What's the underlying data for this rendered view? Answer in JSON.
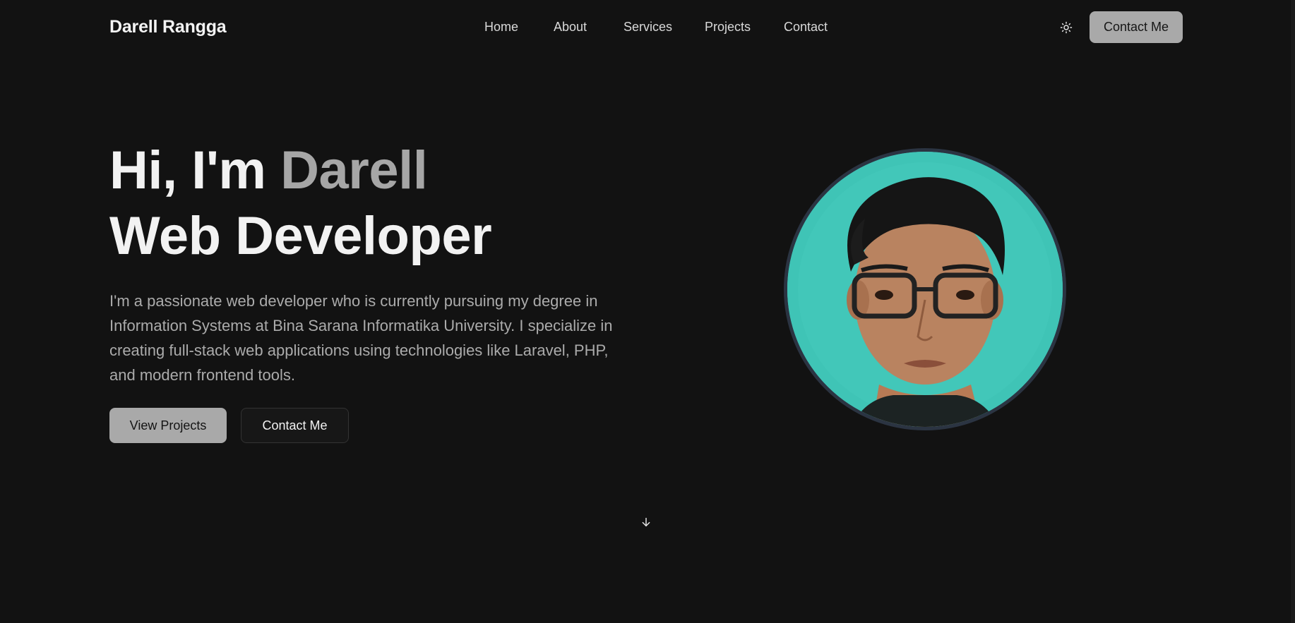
{
  "header": {
    "brand": "Darell Rangga",
    "nav_items": [
      {
        "label": "Home"
      },
      {
        "label": "About"
      },
      {
        "label": "Services"
      },
      {
        "label": "Projects"
      },
      {
        "label": "Contact"
      }
    ],
    "theme_icon": "sun-icon",
    "cta_label": "Contact Me"
  },
  "hero": {
    "greeting": "Hi, I'm ",
    "name": "Darell",
    "role": "Web Developer",
    "description": "I'm a passionate web developer who is currently pursuing my degree in Information Systems at Bina Sarana Informatika University. I specialize in creating full-stack web applications using technologies like Laravel, PHP, and modern frontend tools.",
    "primary_button": "View Projects",
    "secondary_button": "Contact Me",
    "scroll_icon": "arrow-down-icon"
  },
  "colors": {
    "background": "#121212",
    "accent_gray": "#a9a9a9",
    "avatar_bg": "#3fc4b6",
    "avatar_ring": "#2b3442"
  }
}
